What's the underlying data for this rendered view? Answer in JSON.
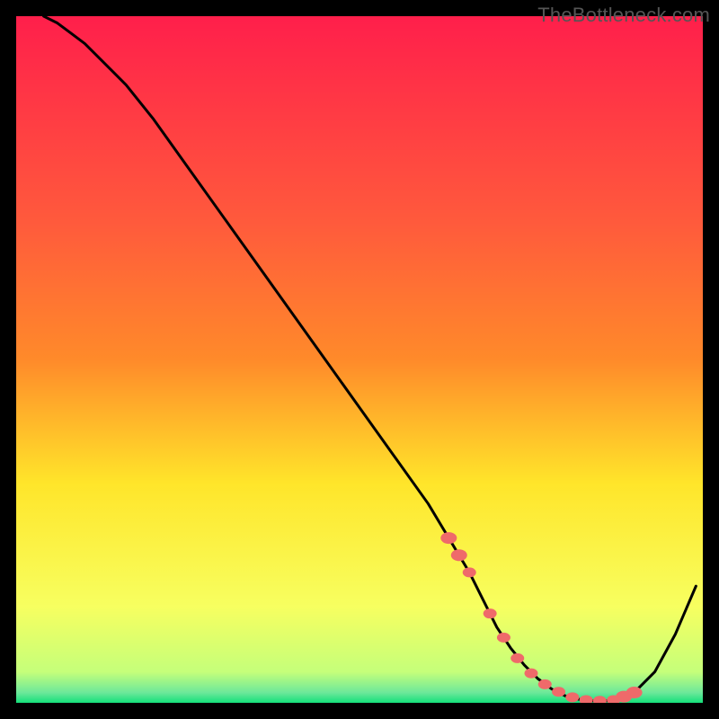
{
  "watermark": "TheBottleneck.com",
  "chart_data": {
    "type": "line",
    "title": "",
    "xlabel": "",
    "ylabel": "",
    "xlim": [
      0,
      100
    ],
    "ylim": [
      0,
      100
    ],
    "grid": false,
    "legend": false,
    "background_gradient": {
      "top": "#ff1f4b",
      "mid_top": "#ff8a2a",
      "mid": "#ffe52a",
      "mid_bottom": "#f7ff60",
      "bottom": "#14e07a"
    },
    "series": [
      {
        "name": "bottleneck-curve",
        "color": "#000000",
        "x": [
          4,
          6,
          8,
          10,
          12,
          16,
          20,
          25,
          30,
          35,
          40,
          45,
          50,
          55,
          60,
          63,
          66,
          68,
          70,
          72,
          74,
          76,
          78,
          80,
          82,
          84,
          86,
          88,
          90,
          93,
          96,
          99
        ],
        "y": [
          100,
          99,
          97.5,
          96,
          94,
          90,
          85,
          78,
          71,
          64,
          57,
          50,
          43,
          36,
          29,
          24,
          19,
          15,
          11,
          8,
          5.5,
          3.5,
          2,
          1,
          0.5,
          0.3,
          0.3,
          0.6,
          1.5,
          4.5,
          10,
          17
        ]
      }
    ],
    "markers": {
      "name": "highlight-points",
      "color": "#ef6a6a",
      "x": [
        63,
        64.5,
        66,
        69,
        71,
        73,
        75,
        77,
        79,
        81,
        83,
        85,
        87,
        88.5,
        90
      ],
      "y": [
        24,
        21.5,
        19,
        13,
        9.5,
        6.5,
        4.3,
        2.7,
        1.6,
        0.8,
        0.4,
        0.3,
        0.4,
        0.9,
        1.5
      ]
    }
  }
}
